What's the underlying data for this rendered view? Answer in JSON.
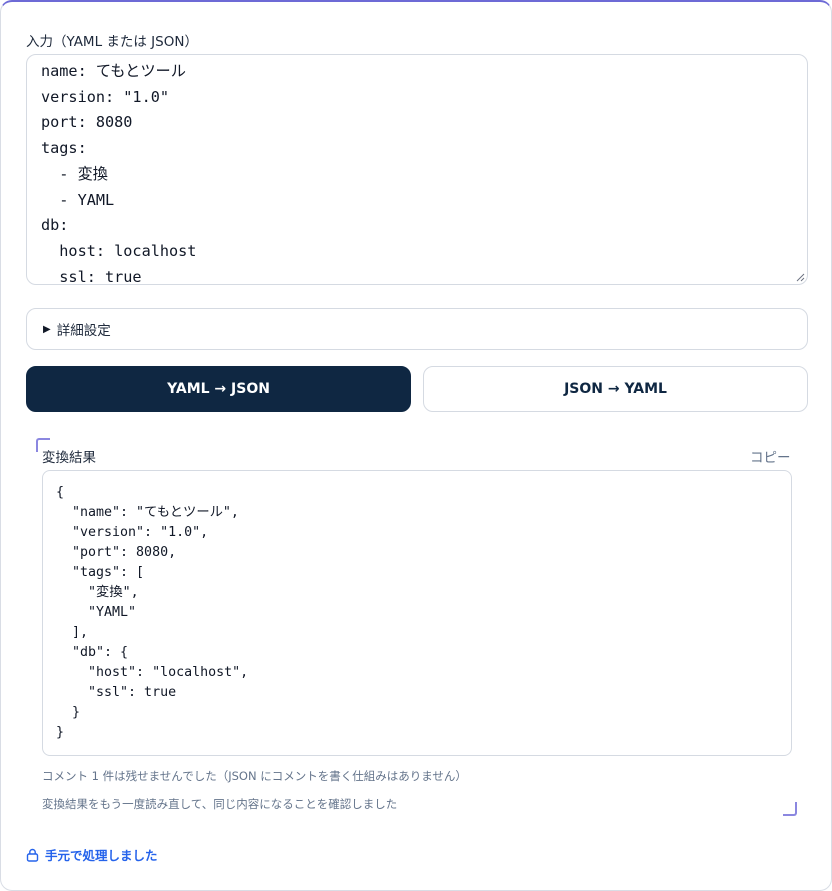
{
  "input": {
    "label": "入力（YAML または JSON）",
    "value": "name: てもとツール\nversion: \"1.0\"\nport: 8080\ntags:\n  - 変換\n  - YAML\ndb:\n  host: localhost\n  ssl: true"
  },
  "details": {
    "marker": "▶",
    "label": "詳細設定"
  },
  "buttons": {
    "yaml_to_json": "YAML → JSON",
    "json_to_yaml": "JSON → YAML"
  },
  "result": {
    "label": "変換結果",
    "copy_label": "コピー",
    "output": "{\n  \"name\": \"てもとツール\",\n  \"version\": \"1.0\",\n  \"port\": 8080,\n  \"tags\": [\n    \"変換\",\n    \"YAML\"\n  ],\n  \"db\": {\n    \"host\": \"localhost\",\n    \"ssl\": true\n  }\n}"
  },
  "notes": [
    "コメント 1 件は残せませんでした（JSON にコメントを書く仕組みはありません）",
    "変換結果をもう一度読み直して、同じ内容になることを確認しました"
  ],
  "footer": {
    "icon": "lock-icon",
    "text": "手元で処理しました"
  },
  "colors": {
    "primary": "#0f2742",
    "accent": "#6d6ad6",
    "link": "#2563eb"
  }
}
